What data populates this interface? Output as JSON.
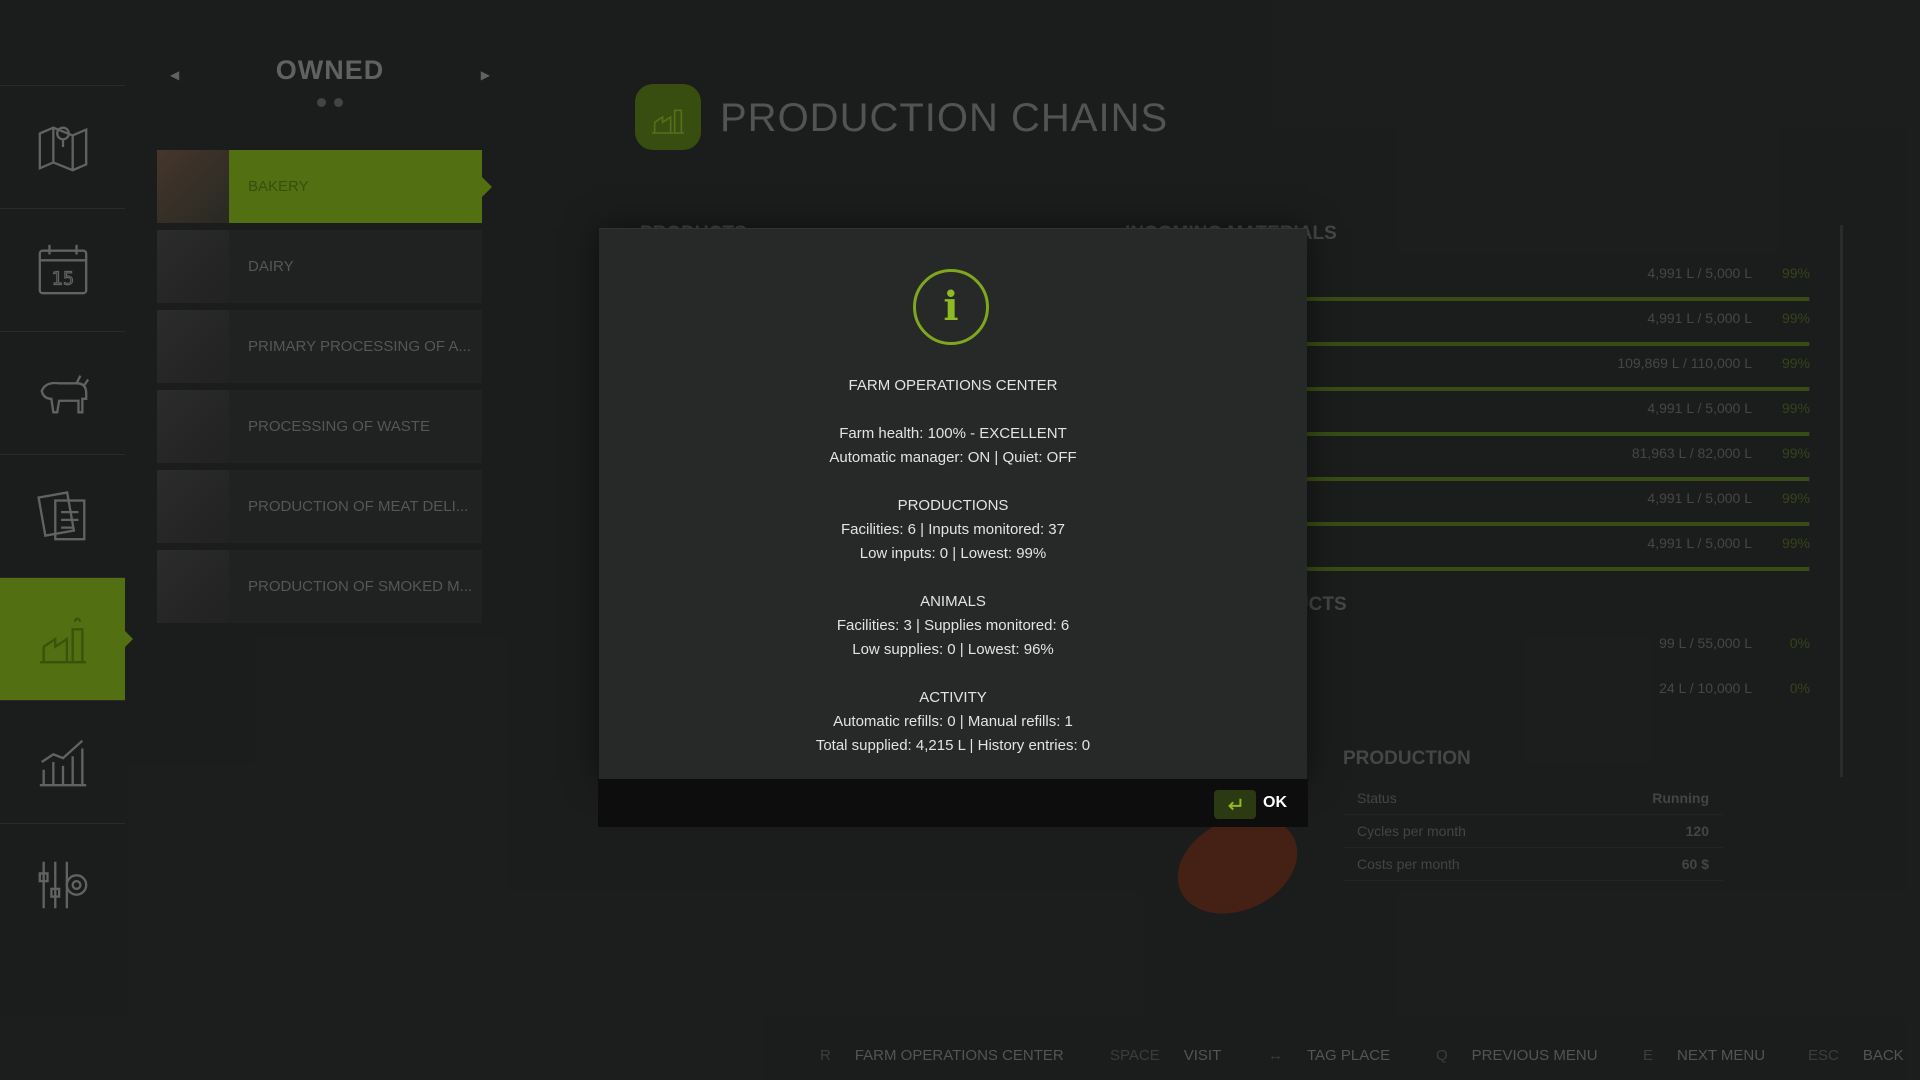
{
  "sidebar": {
    "items": [
      {
        "icon": "map-icon"
      },
      {
        "icon": "calendar-icon",
        "number": "15"
      },
      {
        "icon": "cow-icon"
      },
      {
        "icon": "contracts-icon"
      },
      {
        "icon": "production-icon",
        "active": true
      },
      {
        "icon": "statistics-icon"
      },
      {
        "icon": "settings-icon"
      }
    ]
  },
  "facility_list": {
    "title": "OWNED",
    "items": [
      {
        "label": "BAKERY",
        "active": true
      },
      {
        "label": "DAIRY"
      },
      {
        "label": "PRIMARY PROCESSING OF A..."
      },
      {
        "label": "PROCESSING OF WASTE"
      },
      {
        "label": "PRODUCTION OF MEAT DELI..."
      },
      {
        "label": "PRODUCTION OF SMOKED M..."
      }
    ]
  },
  "page": {
    "title": "PRODUCTION CHAINS",
    "section_producing": "PRODUCTS",
    "section_inputs": "INCOMING MATERIALS",
    "section_outputs": "PRODUCTS",
    "materials": [
      {
        "value": "4,991 L / 5,000 L",
        "pct": "99%",
        "fill": 0.998
      },
      {
        "value": "4,991 L / 5,000 L",
        "pct": "99%",
        "fill": 0.998
      },
      {
        "value": "109,869 L / 110,000 L",
        "pct": "99%",
        "fill": 0.998
      },
      {
        "value": "4,991 L / 5,000 L",
        "pct": "99%",
        "fill": 0.998
      },
      {
        "value": "81,963 L / 82,000 L",
        "pct": "99%",
        "fill": 0.999
      },
      {
        "value": "4,991 L / 5,000 L",
        "pct": "99%",
        "fill": 0.998
      },
      {
        "value": "4,991 L / 5,000 L",
        "pct": "99%",
        "fill": 0.998
      }
    ],
    "products": [
      {
        "value": "99 L / 55,000 L",
        "pct": "0%"
      },
      {
        "value": "24 L / 10,000 L",
        "pct": "0%"
      }
    ],
    "production": {
      "title": "PRODUCTION",
      "rows": [
        {
          "label": "Status",
          "value": "Running"
        },
        {
          "label": "Cycles per month",
          "value": "120"
        },
        {
          "label": "Costs per month",
          "value": "60 $"
        }
      ]
    }
  },
  "dialog": {
    "icon": "info-icon",
    "title": "FARM OPERATIONS CENTER",
    "health": "Farm health: 100% - EXCELLENT",
    "manager": "Automatic manager: ON | Quiet: OFF",
    "productions_head": "PRODUCTIONS",
    "productions_line1": "Facilities: 6 | Inputs monitored: 37",
    "productions_line2": "Low inputs: 0 | Lowest: 99%",
    "animals_head": "ANIMALS",
    "animals_line1": "Facilities: 3 | Supplies monitored: 6",
    "animals_line2": "Low supplies: 0 | Lowest: 96%",
    "activity_head": "ACTIVITY",
    "activity_line1": "Automatic refills: 0 | Manual refills: 1",
    "activity_line2": "Total supplied: 4,215 L | History entries: 0",
    "ok_label": "OK"
  },
  "hints": [
    {
      "key": "R",
      "label": "FARM OPERATIONS CENTER"
    },
    {
      "key": "SPACE",
      "label": "VISIT"
    },
    {
      "key": "↔",
      "label": "TAG PLACE"
    },
    {
      "key": "Q",
      "label": "PREVIOUS MENU"
    },
    {
      "key": "E",
      "label": "NEXT MENU"
    },
    {
      "key": "ESC",
      "label": "BACK"
    }
  ],
  "colors": {
    "accent": "#8fbb22",
    "active_bg": "#5a7a14",
    "background": "#1e1f1f"
  }
}
